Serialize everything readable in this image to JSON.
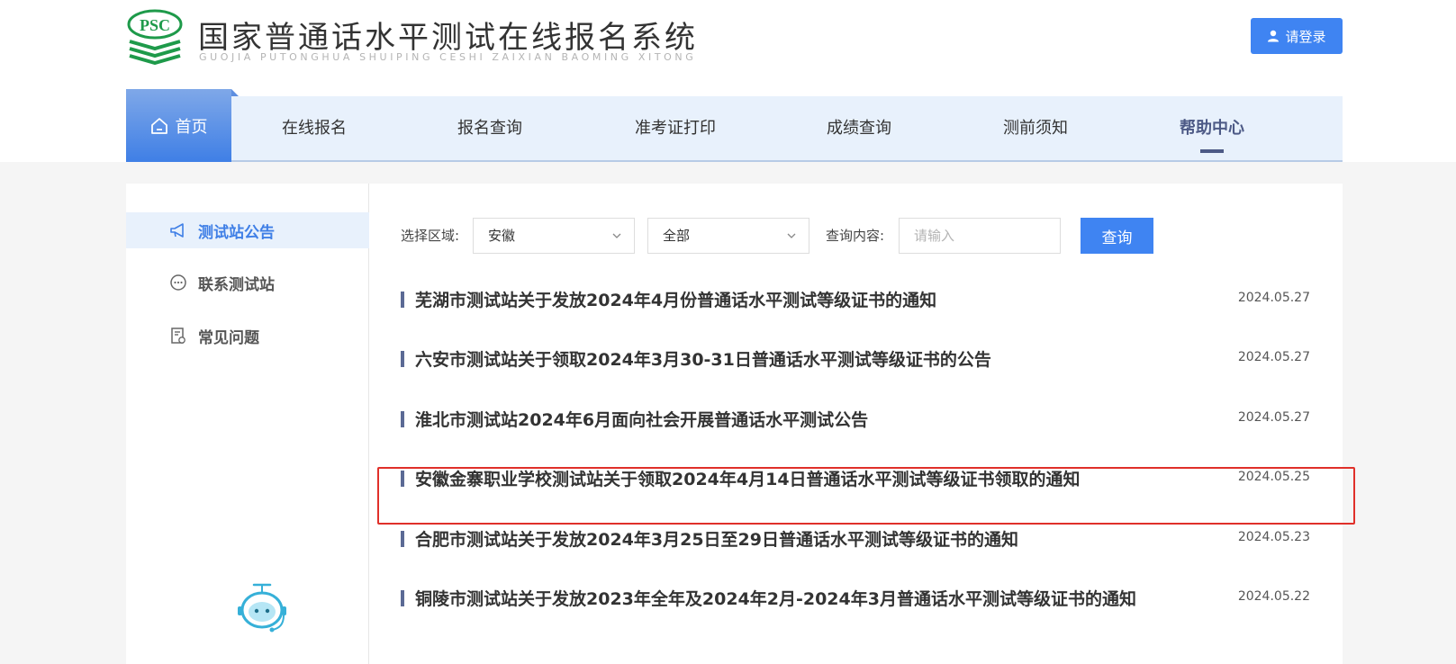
{
  "header": {
    "logo_mark": "PSC",
    "title": "国家普通话水平测试在线报名系统",
    "subtitle": "GUOJIA PUTONGHUA SHUIPING CESHI ZAIXIAN BAOMING XITONG",
    "login_label": "请登录"
  },
  "nav": {
    "home": "首页",
    "items": [
      "在线报名",
      "报名查询",
      "准考证打印",
      "成绩查询",
      "测前须知",
      "帮助中心"
    ],
    "active": "帮助中心"
  },
  "sidebar": {
    "items": [
      {
        "label": "测试站公告",
        "icon": "megaphone-icon",
        "active": true
      },
      {
        "label": "联系测试站",
        "icon": "chat-icon",
        "active": false
      },
      {
        "label": "常见问题",
        "icon": "faq-icon",
        "active": false
      }
    ]
  },
  "filters": {
    "region_label": "选择区域:",
    "region_value": "安徽",
    "scope_value": "全部",
    "content_label": "查询内容:",
    "content_placeholder": "请输入",
    "query_label": "查询"
  },
  "news": [
    {
      "title": "芜湖市测试站关于发放2024年4月份普通话水平测试等级证书的通知",
      "date": "2024.05.27"
    },
    {
      "title": "六安市测试站关于领取2024年3月30-31日普通话水平测试等级证书的公告",
      "date": "2024.05.27"
    },
    {
      "title": "淮北市测试站2024年6月面向社会开展普通话水平测试公告",
      "date": "2024.05.27"
    },
    {
      "title": "安徽金寨职业学校测试站关于领取2024年4月14日普通话水平测试等级证书领取的通知",
      "date": "2024.05.25"
    },
    {
      "title": "合肥市测试站关于发放2024年3月25日至29日普通话水平测试等级证书的通知",
      "date": "2024.05.23"
    },
    {
      "title": "铜陵市测试站关于发放2023年全年及2024年2月-2024年3月普通话水平测试等级证书的通知",
      "date": "2024.05.22"
    }
  ],
  "colors": {
    "accent": "#3f84f2",
    "nav_bg": "#e8f1fc",
    "active_nav": "#4d5a86",
    "highlight_border": "#e0302a",
    "logo_green": "#1e9a4a"
  }
}
